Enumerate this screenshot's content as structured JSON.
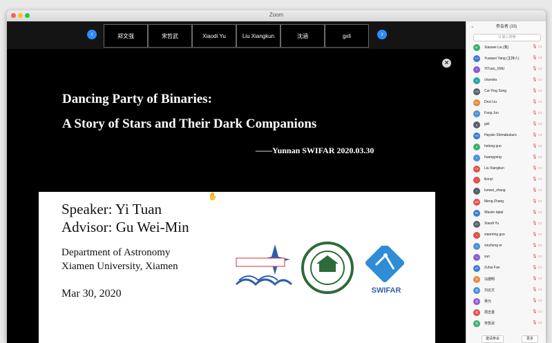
{
  "window": {
    "title": "Zoom"
  },
  "video_strip": {
    "tiles": [
      "郑文强",
      "宋哲武",
      "Xiaodi Yu",
      "Liu Xiangkun",
      "沈涵",
      "gxli"
    ]
  },
  "slide": {
    "title_line1": "Dancing Party of Binaries:",
    "title_line2": "A Story of Stars and Their Dark Companions",
    "signature": "——Yunnan SWIFAR 2020.03.30",
    "speaker": "Speaker: Yi Tuan",
    "advisor": "Advisor: Gu Wei-Min",
    "dept_line1": "Department of Astronomy",
    "dept_line2": "Xiamen University, Xiamen",
    "date": "Mar 30, 2020",
    "logos": {
      "xmu_text": "厦门大学天文学系",
      "xmu_sub": "Department of Astronomy Xiamen University",
      "yunnan_text": "YUNNAN UNIVERSITY",
      "swifar_text": "SWIFAR"
    }
  },
  "participants_panel": {
    "header": "参会者 (33)",
    "search_placeholder": "Q 输入搜索",
    "participants": [
      {
        "initials": "XL",
        "name": "Xiaowei Liu (我)",
        "color": "#3bb06c"
      },
      {
        "initials": "YY",
        "name": "Yuanpei Yang (主持人)",
        "color": "#3a7bd5"
      },
      {
        "initials": "Y",
        "name": "YiTuan_XMU",
        "color": "#8e5bd0"
      },
      {
        "initials": "c",
        "name": "chandra",
        "color": "#2aa7a0"
      },
      {
        "initials": "CS",
        "name": "Cui-Ying Song",
        "color": "#555e6b"
      },
      {
        "initials": "DL",
        "name": "Dezi Liu",
        "color": "#e58a3c"
      },
      {
        "initials": "FJ",
        "name": "Fang Jun",
        "color": "#4a90d9"
      },
      {
        "initials": "g",
        "name": "gxli",
        "color": "#555e6b"
      },
      {
        "initials": "HS",
        "name": "Hayato Shimabukuro",
        "color": "#3a7bd5"
      },
      {
        "initials": "h",
        "name": "heleng guo",
        "color": "#3bb06c"
      },
      {
        "initials": "h",
        "name": "huangyang",
        "color": "#4a90d9"
      },
      {
        "initials": "LX",
        "name": "Liu Xiangkun",
        "color": "#e0514b"
      },
      {
        "initials": "l",
        "name": "liionyi",
        "color": "#e0514b"
      },
      {
        "initials": "l",
        "name": "lunwei_zhang",
        "color": "#555e6b"
      },
      {
        "initials": "MZ",
        "name": "Meng Zhang",
        "color": "#e0514b"
      },
      {
        "initials": "WI",
        "name": "Wasim Iqbal",
        "color": "#3a7bd5"
      },
      {
        "initials": "XY",
        "name": "Xiaodi Yu",
        "color": "#555e6b"
      },
      {
        "initials": "x",
        "name": "xiaoming guo",
        "color": "#e0514b"
      },
      {
        "initials": "x",
        "name": "xinzheng er",
        "color": "#4a90d9"
      },
      {
        "initials": "x",
        "name": "xun",
        "color": "#8e5bd0"
      },
      {
        "initials": "ZF",
        "name": "Zuhui Fan",
        "color": "#3a7bd5"
      },
      {
        "initials": "冯",
        "name": "冯德明",
        "color": "#e58a3c"
      },
      {
        "initials": "刘",
        "name": "刘云文",
        "color": "#4a90d9"
      },
      {
        "initials": "吴",
        "name": "吴元",
        "color": "#8e5bd0"
      },
      {
        "initials": "周",
        "name": "周志勇",
        "color": "#e0514b"
      },
      {
        "initials": "宋",
        "name": "宋哲武",
        "color": "#3bb06c"
      }
    ],
    "footer_left": "邀请参会",
    "footer_right": "更多"
  }
}
